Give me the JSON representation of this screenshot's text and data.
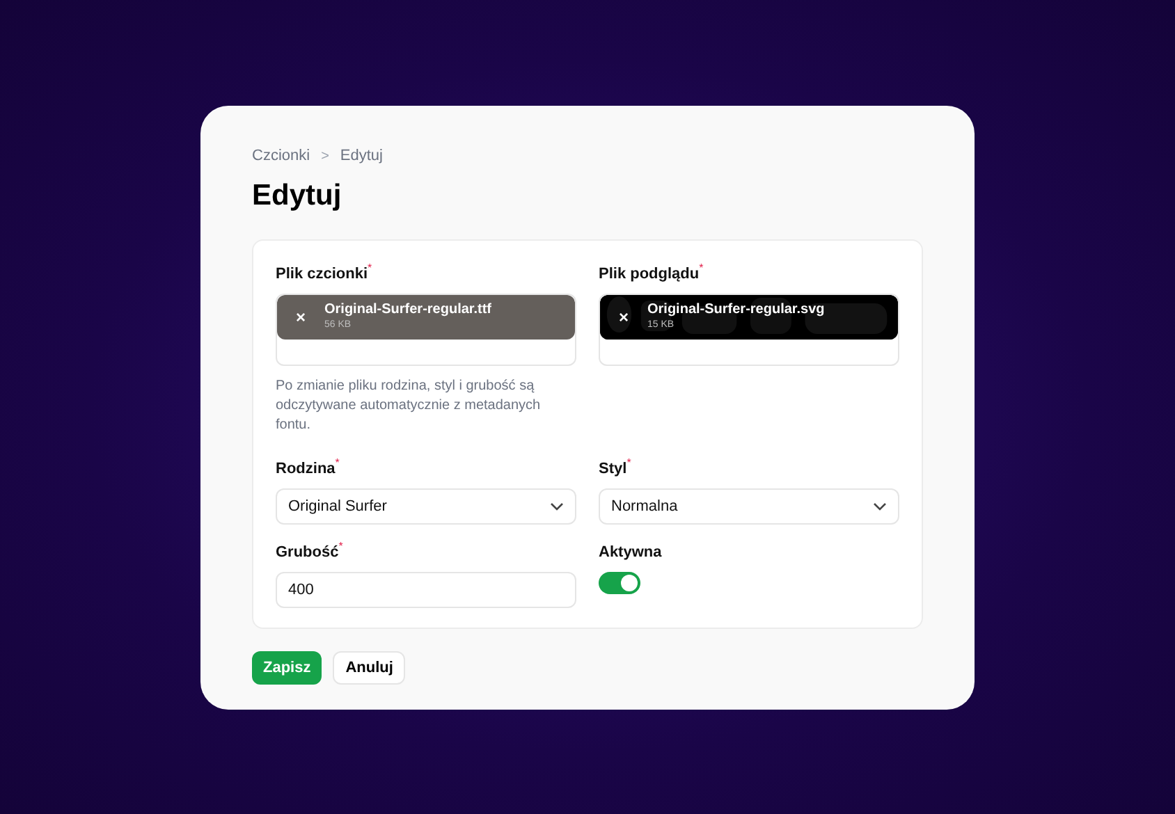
{
  "breadcrumb": [
    {
      "label": "Czcionki"
    },
    {
      "label": "Edytuj"
    }
  ],
  "breadcrumb_separator": ">",
  "title": "Edytuj",
  "required_mark": "*",
  "files": [
    {
      "label": "Plik czcionki",
      "required": true,
      "kind": "font",
      "name": "Original-Surfer-regular.ttf",
      "size": "56 KB",
      "remove": "×",
      "hint": "Po zmianie pliku rodzina, styl i grubość są odczytywane automatycznie z metadanych fontu."
    },
    {
      "label": "Plik podglądu",
      "required": true,
      "kind": "preview",
      "name": "Original-Surfer-regular.svg",
      "size": "15 KB",
      "remove": "×"
    }
  ],
  "fields": [
    {
      "label": "Rodzina",
      "required": true,
      "kind": "select",
      "value": "Original Surfer"
    },
    {
      "label": "Styl",
      "required": true,
      "kind": "select",
      "value": "Normalna"
    },
    {
      "label": "Grubość",
      "required": true,
      "kind": "input",
      "value": "400"
    },
    {
      "label": "Aktywna",
      "required": false,
      "kind": "toggle",
      "on": true
    }
  ],
  "buttons": [
    {
      "label": "Zapisz",
      "kind": "primary"
    },
    {
      "label": "Anuluj",
      "kind": "secondary"
    }
  ]
}
